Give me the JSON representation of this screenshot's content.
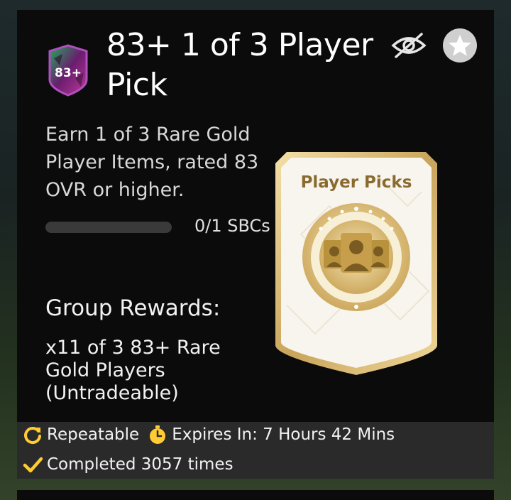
{
  "sbc": {
    "badge_text": "83+",
    "title": "83+ 1 of 3 Player Pick",
    "description": "Earn 1 of 3 Rare Gold Player Items, rated 83 OVR or higher.",
    "progress": {
      "fraction": 0.0,
      "text": "0/1 SBCs"
    },
    "group_rewards_heading": "Group Rewards:",
    "group_rewards_text": "x11 of 3 83+ Rare Gold Players (Untradeable)",
    "pack_label": "Player Picks"
  },
  "actions": {
    "hide_icon": "eye-off-icon",
    "favorite_icon": "star-icon"
  },
  "footer": {
    "repeatable_label": "Repeatable",
    "expires_label": "Expires In: 7 Hours 42 Mins",
    "completed_label": "Completed 3057 times"
  },
  "colors": {
    "accent": "#ffcc33",
    "card_bg": "#0b0b0b",
    "footer_bg": "#2a2a2a",
    "pack_gold": "#d4b36a"
  }
}
